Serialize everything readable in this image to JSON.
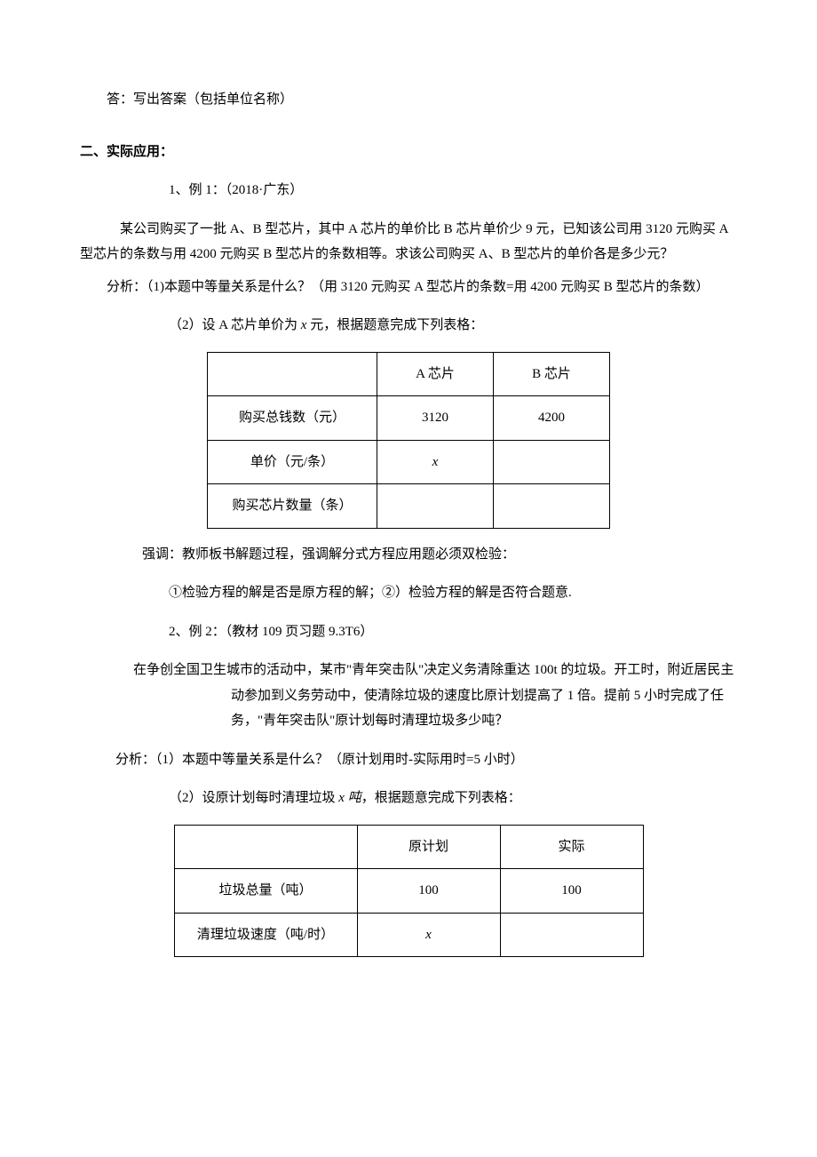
{
  "top_line": "答：写出答案（包括单位名称）",
  "section2": {
    "title": "二、实际应用：",
    "item1_label": "1、例 1：（2018·广东）",
    "item1_body": "某公司购买了一批 A、B 型芯片，其中 A 芯片的单价比 B 芯片单价少 9 元，已知该公司用 3120 元购买 A 型芯片的条数与用 4200 元购买 B 型芯片的条数相等。求该公司购买 A、B 型芯片的单价各是多少元？",
    "item1_analysis1": "分析：（1)本题中等量关系是什么？（用 3120 元购买 A 型芯片的条数=用 4200 元购买 B 型芯片的条数）",
    "item1_analysis2_pre": "（2）设 A 芯片单价为 ",
    "item1_analysis2_var": "x",
    "item1_analysis2_post": " 元，根据题意完成下列表格：",
    "table1": {
      "h_blank": "",
      "h_a": "A 芯片",
      "h_b": "B 芯片",
      "r1_label": "购买总钱数（元）",
      "r1_a": "3120",
      "r1_b": "4200",
      "r2_label": "单价（元/条）",
      "r2_a": "x",
      "r2_b": "",
      "r3_label": "购买芯片数量（条）",
      "r3_a": "",
      "r3_b": ""
    },
    "stress_line": "强调：教师板书解题过程，强调解分式方程应用题必须双检验：",
    "stress_sub": "①检验方程的解是否是原方程的解；②）检验方程的解是否符合题意.",
    "item2_label": "2、例 2：（教材 109 页习题 9.3T6）",
    "item2_body": "在争创全国卫生城市的活动中，某市\"青年突击队\"决定义务清除重达 100t 的垃圾。开工时，附近居民主动参加到义务劳动中，使清除垃圾的速度比原计划提高了 1 倍。提前 5 小时完成了任务，\"青年突击队\"原计划每时清理垃圾多少吨？",
    "item2_analysis1": "分析：（1）本题中等量关系是什么？（原计划用时-实际用时=5 小时）",
    "item2_analysis2_pre": "（2）设原计划每时清理垃圾 ",
    "item2_analysis2_var": "x",
    "item2_analysis2_unit": " 吨",
    "item2_analysis2_post": "，根据题意完成下列表格：",
    "table2": {
      "h_blank": "",
      "h_a": "原计划",
      "h_b": "实际",
      "r1_label": "垃圾总量（吨）",
      "r1_a": "100",
      "r1_b": "100",
      "r2_label": "清理垃圾速度（吨/时）",
      "r2_a": "x",
      "r2_b": ""
    }
  }
}
